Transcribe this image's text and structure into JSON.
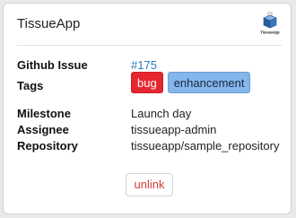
{
  "app": {
    "title": "TissueApp",
    "logo_icon": "tissueapp-logo-icon",
    "logo_text": "TissueApp"
  },
  "fields": {
    "github_issue": {
      "label": "Github Issue",
      "value": "#175"
    },
    "tags": {
      "label": "Tags",
      "items": [
        {
          "text": "bug",
          "color": "#e5262f"
        },
        {
          "text": "enhancement",
          "color": "#84b6eb"
        }
      ]
    },
    "milestone": {
      "label": "Milestone",
      "value": "Launch day"
    },
    "assignee": {
      "label": "Assignee",
      "value": "tissueapp-admin"
    },
    "repository": {
      "label": "Repository",
      "value": "tissueapp/sample_repository"
    }
  },
  "actions": {
    "unlink_label": "unlink"
  },
  "colors": {
    "link": "#2a7ab8",
    "danger_text": "#d33a3a"
  }
}
